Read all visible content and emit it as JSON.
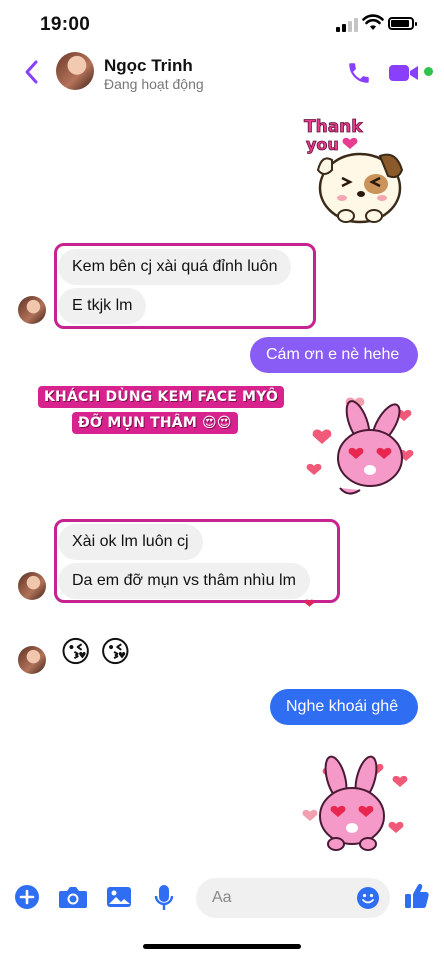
{
  "status_bar": {
    "time": "19:00"
  },
  "header": {
    "contact_name": "Ngọc Trinh",
    "contact_status": "Đang hoạt động"
  },
  "stickers": {
    "thank_you_text": "Thank you"
  },
  "messages": {
    "in_group_1": [
      "Kem bên cj xài quá đỉnh luôn",
      "E tkjk lm"
    ],
    "out_1": "Cám ơn e nè hehe",
    "promo_line_1": "KHÁCH DÙNG KEM FACE MYÔ",
    "promo_line_2": "ĐỠ MỤN THÂM 😍😍",
    "in_group_2": [
      "Xài ok lm luôn cj",
      "Da em đỡ mụn vs thâm nhìu lm"
    ],
    "reaction": "❤",
    "emojis": "😘 😘",
    "out_2": "Nghe khoái ghê"
  },
  "composer": {
    "placeholder": "Aa"
  },
  "colors": {
    "accent": "#8a3ffc",
    "outgoing_1": "#8a5cf6",
    "outgoing_2": "#2f6ef2",
    "highlight": "#c6238f"
  }
}
